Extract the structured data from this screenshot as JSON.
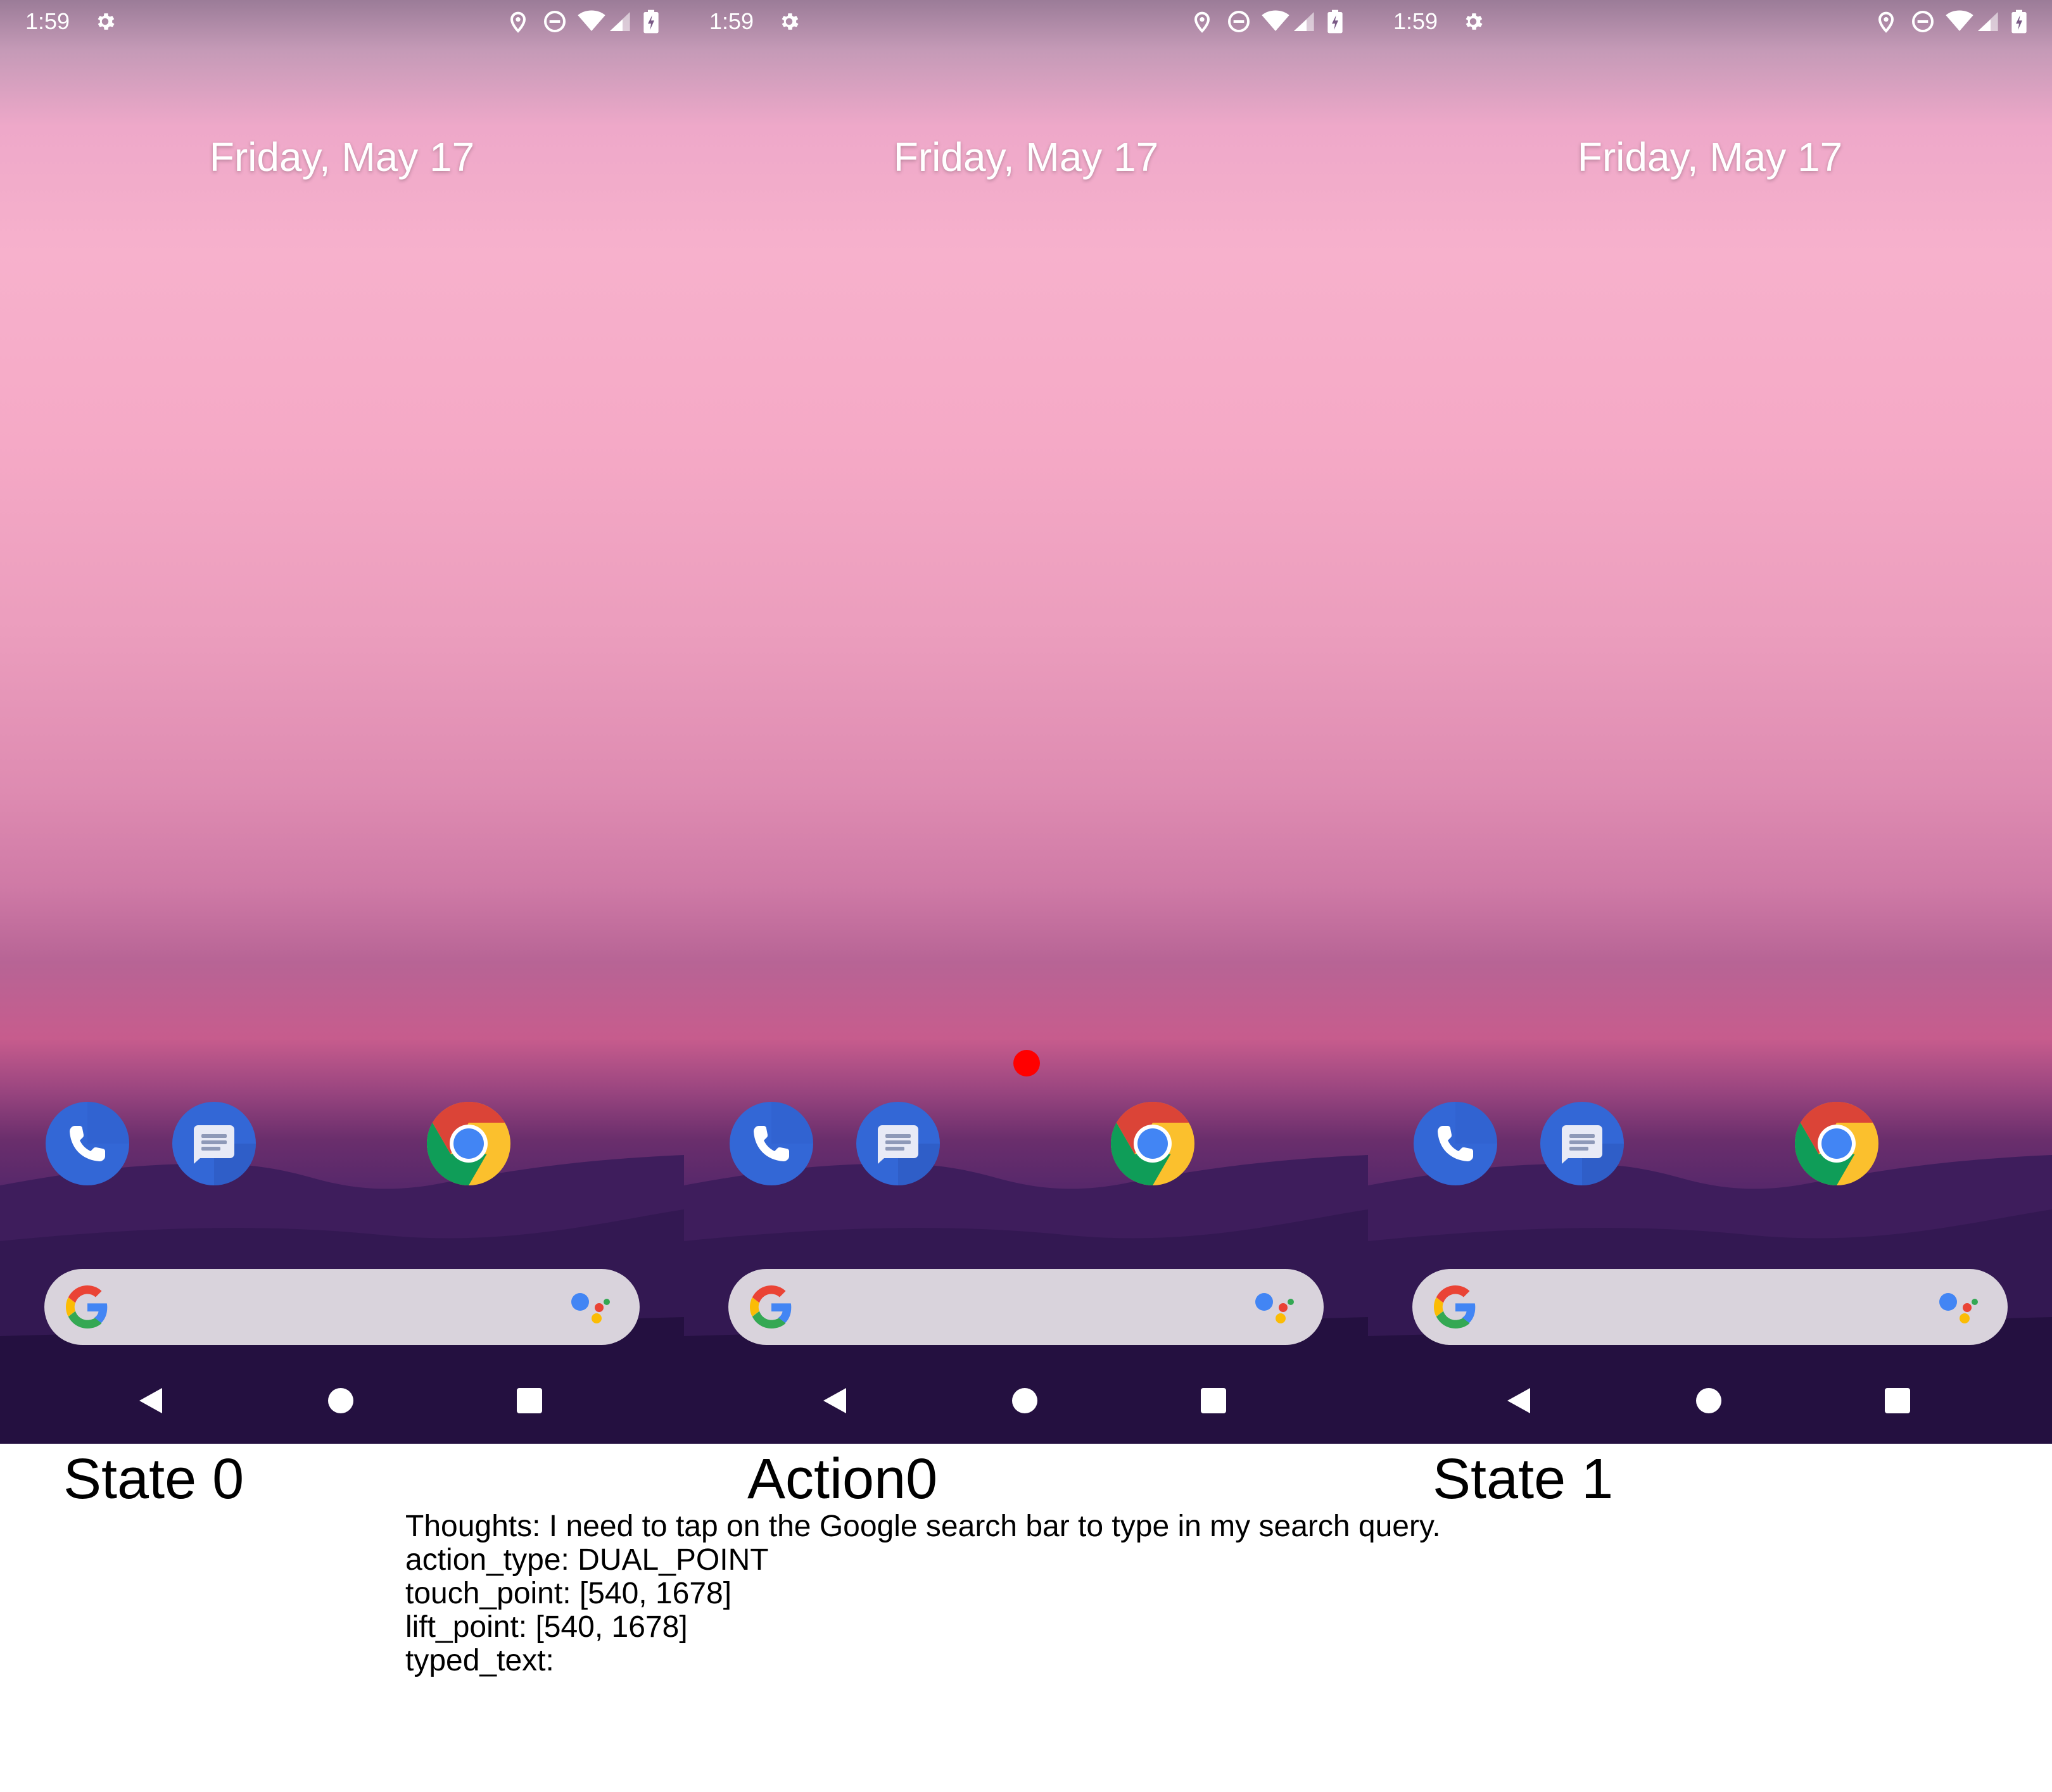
{
  "panels": [
    {
      "status_time": "1:59",
      "date": "Friday, May 17",
      "apps": [
        "phone-icon",
        "messages-icon",
        "chrome-icon"
      ],
      "show_tap": false
    },
    {
      "status_time": "1:59",
      "date": "Friday, May 17",
      "apps": [
        "phone-icon",
        "messages-icon",
        "chrome-icon"
      ],
      "show_tap": true
    },
    {
      "status_time": "1:59",
      "date": "Friday, May 17",
      "apps": [
        "phone-icon",
        "messages-icon",
        "chrome-icon"
      ],
      "show_tap": false
    }
  ],
  "captions": {
    "state0": "State 0",
    "action0": "Action0",
    "state1": "State 1"
  },
  "details": {
    "thoughts": "Thoughts: I need to tap on the Google search bar to type in my search query.",
    "action_type": "action_type: DUAL_POINT",
    "touch_point": "touch_point: [540, 1678]",
    "lift_point": "lift_point: [540, 1678]",
    "typed_text": "typed_text:"
  },
  "colors": {
    "tap_marker": "#ff0000",
    "app_blue": "#3367d6",
    "search_bar": "#d9d3dc"
  },
  "status_icons": [
    "settings-icon",
    "location-icon",
    "do-not-disturb-icon",
    "wifi-icon",
    "signal-icon",
    "battery-charging-icon"
  ],
  "nav_icons": [
    "back-icon",
    "home-icon",
    "recents-icon"
  ]
}
